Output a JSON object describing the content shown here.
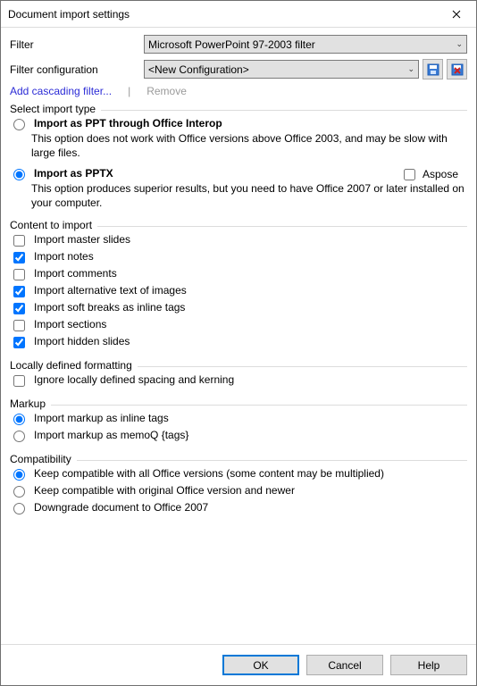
{
  "window": {
    "title": "Document import settings"
  },
  "filter": {
    "label": "Filter",
    "value": "Microsoft PowerPoint 97-2003 filter"
  },
  "config": {
    "label": "Filter configuration",
    "value": "<New Configuration>"
  },
  "links": {
    "add": "Add cascading filter...",
    "sep": "|",
    "remove": "Remove"
  },
  "import_type": {
    "title": "Select import type",
    "opt1": {
      "label": "Import as PPT through Office Interop",
      "desc": "This option does not work with Office versions above Office 2003, and may be slow with large files."
    },
    "opt2": {
      "label": "Import as PPTX",
      "aspose": "Aspose",
      "desc": "This option produces superior results, but you need to have Office 2007 or later installed on your computer."
    }
  },
  "content": {
    "title": "Content to import",
    "items": [
      "Import master slides",
      "Import notes",
      "Import comments",
      "Import alternative text of images",
      "Import soft breaks as inline tags",
      "Import sections",
      "Import hidden slides"
    ]
  },
  "locally": {
    "title": "Locally defined formatting",
    "item": "Ignore locally defined spacing and kerning"
  },
  "markup": {
    "title": "Markup",
    "opt1": "Import markup as inline tags",
    "opt2": "Import markup as memoQ {tags}"
  },
  "compat": {
    "title": "Compatibility",
    "opt1": "Keep compatible with all Office versions (some content may be multiplied)",
    "opt2": "Keep compatible with original Office version and newer",
    "opt3": "Downgrade document to Office 2007"
  },
  "buttons": {
    "ok": "OK",
    "cancel": "Cancel",
    "help": "Help"
  }
}
